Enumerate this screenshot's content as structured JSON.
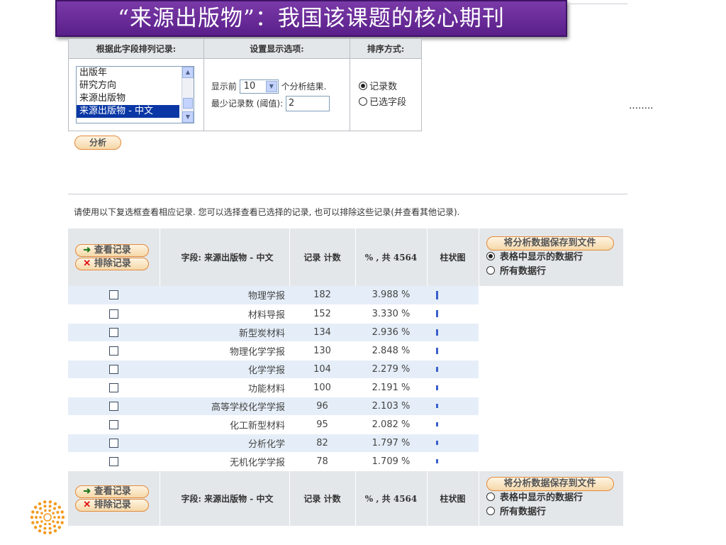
{
  "title": "“来源出版物”：我国该课题的核心期刊",
  "ellipsis": "……..",
  "settings": {
    "headers": [
      "根据此字段排列记录:",
      "设置显示选项:",
      "排序方式:"
    ],
    "field_options": [
      "出版年",
      "研究方向",
      "来源出版物",
      "来源出版物 - 中文"
    ],
    "selected_field": "来源出版物 - 中文",
    "show_prefix": "显示前",
    "show_count": "10",
    "show_suffix": "个分析结果.",
    "min_records_label": "最少记录数 (阈值):",
    "min_records_value": "2",
    "sort_options": [
      "记录数",
      "已选字段"
    ],
    "sort_selected": "记录数",
    "analyze_label": "分析"
  },
  "instructions": "请使用以下复选框查看相应记录. 您可以选择查看已选择的记录, 也可以排除这些记录(并查看其他记录).",
  "table": {
    "view_records_label": "查看记录",
    "exclude_records_label": "排除记录",
    "field_header": "字段: 来源出版物 - 中文",
    "count_header": "记录 计数",
    "percent_header": "% , 共 4564",
    "bar_header": "柱状图",
    "save_label": "将分析数据保存到文件",
    "save_options": [
      "表格中显示的数据行",
      "所有数据行"
    ],
    "save_selected_top": "表格中显示的数据行",
    "total": 4564,
    "rows": [
      {
        "name": "物理学报",
        "count": "182",
        "percent": "3.988 %"
      },
      {
        "name": "材料导报",
        "count": "152",
        "percent": "3.330 %"
      },
      {
        "name": "新型炭材料",
        "count": "134",
        "percent": "2.936 %"
      },
      {
        "name": "物理化学学报",
        "count": "130",
        "percent": "2.848 %"
      },
      {
        "name": "化学学报",
        "count": "104",
        "percent": "2.279 %"
      },
      {
        "name": "功能材料",
        "count": "100",
        "percent": "2.191 %"
      },
      {
        "name": "高等学校化学学报",
        "count": "96",
        "percent": "2.103 %"
      },
      {
        "name": "化工新型材料",
        "count": "95",
        "percent": "2.082 %"
      },
      {
        "name": "分析化学",
        "count": "82",
        "percent": "1.797 %"
      },
      {
        "name": "无机化学学报",
        "count": "78",
        "percent": "1.709 %"
      }
    ]
  },
  "colors": {
    "banner": "#6a2c98",
    "header_bg": "#e4e7ea",
    "row_alt": "#e5eef8",
    "bar": "#3a5fcd",
    "pill_border": "#e28a3c",
    "logo": "#f39a1e"
  }
}
